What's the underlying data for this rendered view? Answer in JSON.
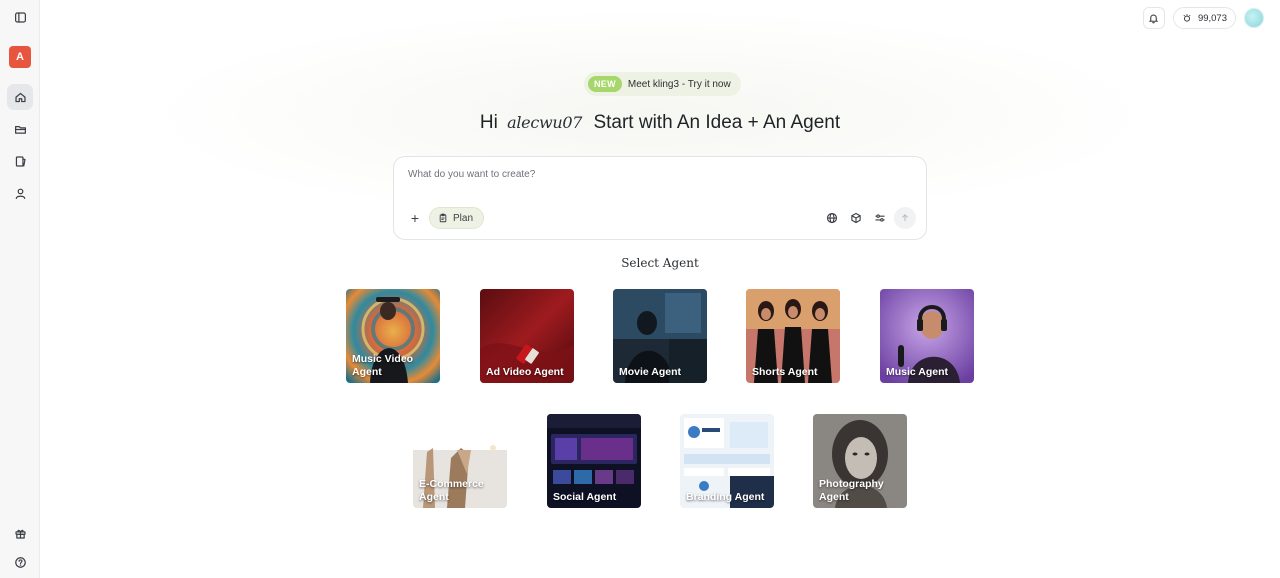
{
  "sidebar": {
    "workspace_initial": "A",
    "items": [
      {
        "name": "sidebar-toggle"
      },
      {
        "name": "home"
      },
      {
        "name": "projects"
      },
      {
        "name": "library"
      },
      {
        "name": "profile"
      }
    ],
    "bottom": [
      {
        "name": "gift"
      },
      {
        "name": "help"
      }
    ]
  },
  "topbar": {
    "credits": "99,073"
  },
  "announcement": {
    "badge": "NEW",
    "text": "Meet kling3 - Try it now"
  },
  "headline": {
    "greeting": "Hi",
    "username": "alecwu07",
    "tagline": "Start with An Idea + An Agent"
  },
  "composer": {
    "placeholder": "What do you want to create?",
    "plan_label": "Plan"
  },
  "agents": {
    "title": "Select Agent",
    "row1": [
      {
        "label": "Music Video Agent"
      },
      {
        "label": "Ad Video Agent"
      },
      {
        "label": "Movie Agent"
      },
      {
        "label": "Shorts Agent"
      },
      {
        "label": "Music Agent"
      }
    ],
    "row2": [
      {
        "label": "E-Commerce Agent"
      },
      {
        "label": "Social Agent"
      },
      {
        "label": "Branding Agent"
      },
      {
        "label": "Photography Agent"
      }
    ]
  }
}
